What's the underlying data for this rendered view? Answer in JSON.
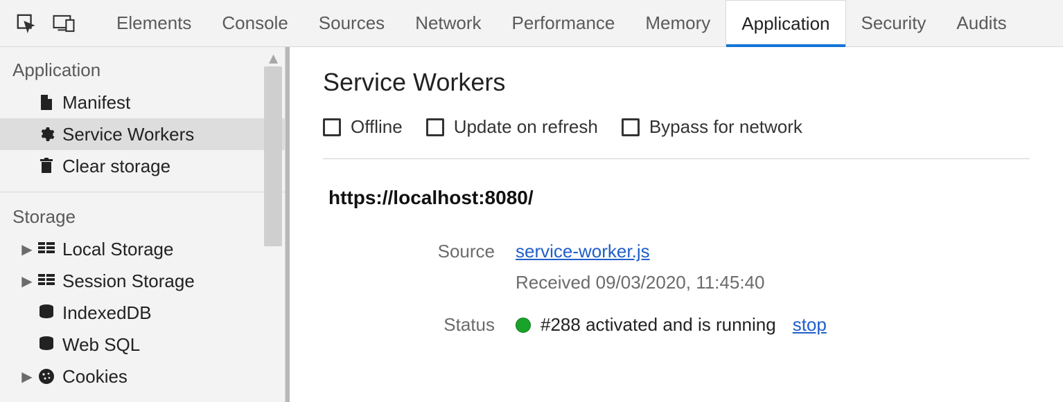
{
  "tabs": {
    "items": [
      {
        "label": "Elements"
      },
      {
        "label": "Console"
      },
      {
        "label": "Sources"
      },
      {
        "label": "Network"
      },
      {
        "label": "Performance"
      },
      {
        "label": "Memory"
      },
      {
        "label": "Application"
      },
      {
        "label": "Security"
      },
      {
        "label": "Audits"
      }
    ],
    "active_index": 6
  },
  "sidebar": {
    "sections": {
      "application": {
        "header": "Application",
        "items": [
          {
            "label": "Manifest"
          },
          {
            "label": "Service Workers"
          },
          {
            "label": "Clear storage"
          }
        ],
        "selected_index": 1
      },
      "storage": {
        "header": "Storage",
        "items": [
          {
            "label": "Local Storage"
          },
          {
            "label": "Session Storage"
          },
          {
            "label": "IndexedDB"
          },
          {
            "label": "Web SQL"
          },
          {
            "label": "Cookies"
          }
        ]
      }
    }
  },
  "panel": {
    "title": "Service Workers",
    "checkboxes": {
      "offline": "Offline",
      "update_on_refresh": "Update on refresh",
      "bypass_for_network": "Bypass for network"
    },
    "origin": "https://localhost:8080/",
    "source": {
      "label": "Source",
      "file": "service-worker.js",
      "received": "Received 09/03/2020, 11:45:40"
    },
    "status": {
      "label": "Status",
      "text": "#288 activated and is running",
      "stop_label": "stop",
      "color": "#19a32a"
    }
  }
}
